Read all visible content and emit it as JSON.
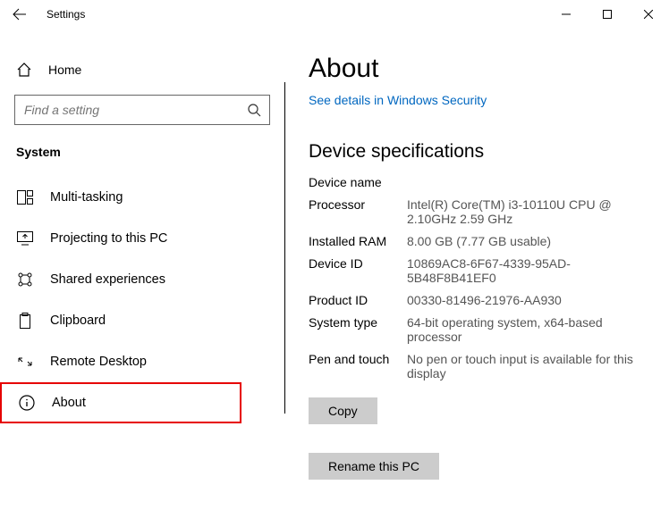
{
  "window": {
    "title": "Settings"
  },
  "sidebar": {
    "home_label": "Home",
    "search_placeholder": "Find a setting",
    "category": "System",
    "items": [
      {
        "label": "Multi-tasking"
      },
      {
        "label": "Projecting to this PC"
      },
      {
        "label": "Shared experiences"
      },
      {
        "label": "Clipboard"
      },
      {
        "label": "Remote Desktop"
      },
      {
        "label": "About"
      }
    ]
  },
  "main": {
    "heading": "About",
    "security_link": "See details in Windows Security",
    "specs_heading": "Device specifications",
    "device_name_label": "Device name",
    "specs": {
      "processor_label": "Processor",
      "processor_value": "Intel(R) Core(TM) i3-10110U CPU @ 2.10GHz   2.59 GHz",
      "ram_label": "Installed RAM",
      "ram_value": "8.00 GB (7.77 GB usable)",
      "device_id_label": "Device ID",
      "device_id_value": "10869AC8-6F67-4339-95AD-5B48F8B41EF0",
      "product_id_label": "Product ID",
      "product_id_value": "00330-81496-21976-AA930",
      "system_type_label": "System type",
      "system_type_value": "64-bit operating system, x64-based processor",
      "pen_touch_label": "Pen and touch",
      "pen_touch_value": "No pen or touch input is available for this display"
    },
    "copy_button": "Copy",
    "rename_button": "Rename this PC"
  }
}
